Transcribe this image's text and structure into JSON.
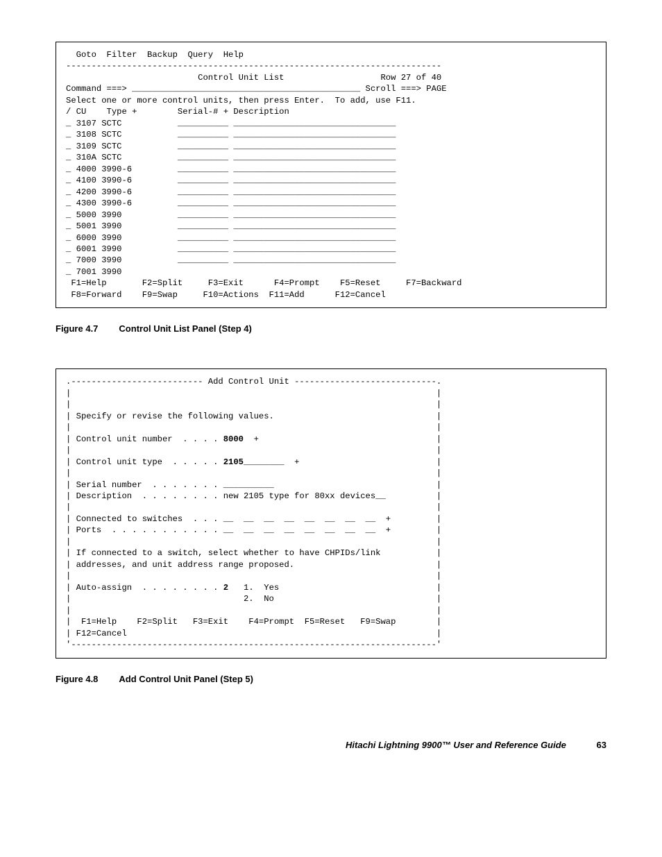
{
  "panel1": {
    "menu": "  Goto  Filter  Backup  Query  Help",
    "sep": "--------------------------------------------------------------------------",
    "title_line": "                          Control Unit List                   Row 27 of 40",
    "cmd_line": "Command ===> _____________________________________________ Scroll ===> PAGE",
    "instr": "Select one or more control units, then press Enter.  To add, use F11.",
    "header": "/ CU    Type +        Serial-# + Description",
    "rows": [
      "_ 3107 SCTC           __________ ________________________________",
      "_ 3108 SCTC           __________ ________________________________",
      "_ 3109 SCTC           __________ ________________________________",
      "_ 310A SCTC           __________ ________________________________",
      "_ 4000 3990-6         __________ ________________________________",
      "_ 4100 3990-6         __________ ________________________________",
      "_ 4200 3990-6         __________ ________________________________",
      "_ 4300 3990-6         __________ ________________________________",
      "_ 5000 3990           __________ ________________________________",
      "_ 5001 3990           __________ ________________________________",
      "_ 6000 3990           __________ ________________________________",
      "_ 6001 3990           __________ ________________________________",
      "_ 7000 3990           __________ ________________________________",
      "_ 7001 3990"
    ],
    "fk1": " F1=Help       F2=Split     F3=Exit      F4=Prompt    F5=Reset     F7=Backward",
    "fk2": " F8=Forward    F9=Swap     F10=Actions  F11=Add      F12=Cancel"
  },
  "caption1": {
    "label": "Figure 4.7",
    "text": "Control Unit List Panel (Step 4)"
  },
  "panel2": {
    "top": ".-------------------------- Add Control Unit ----------------------------.",
    "blank": "|                                                                        |",
    "l1": "| Specify or revise the following values.                                |",
    "l2a": "| Control unit number  . . . . ",
    "l2b": "8000",
    "l2c": "  +                                   |",
    "l3a": "| Control unit type  . . . . . ",
    "l3b": "2105",
    "l3c": "________  +                           |",
    "l4": "| Serial number  . . . . . . . __________                                |",
    "l5": "| Description  . . . . . . . . new 2105 type for 80xx devices__          |",
    "l6": "| Connected to switches  . . . __  __  __  __  __  __  __  __  +         |",
    "l7": "| Ports  . . . . . . . . . . . __  __  __  __  __  __  __  __  +         |",
    "l8": "| If connected to a switch, select whether to have CHPIDs/link           |",
    "l9": "| addresses, and unit address range proposed.                            |",
    "l10a": "| Auto-assign  . . . . . . . . ",
    "l10b": "2",
    "l10c": "   1.  Yes                               |",
    "l11": "|                                  2.  No                                |",
    "l12": "|  F1=Help    F2=Split   F3=Exit    F4=Prompt  F5=Reset   F9=Swap        |",
    "l13": "| F12=Cancel                                                             |",
    "bot": "'------------------------------------------------------------------------'"
  },
  "caption2": {
    "label": "Figure 4.8",
    "text": "Add Control Unit Panel (Step 5)"
  },
  "footer": {
    "title": "Hitachi Lightning 9900™ User and Reference Guide",
    "page": "63"
  }
}
